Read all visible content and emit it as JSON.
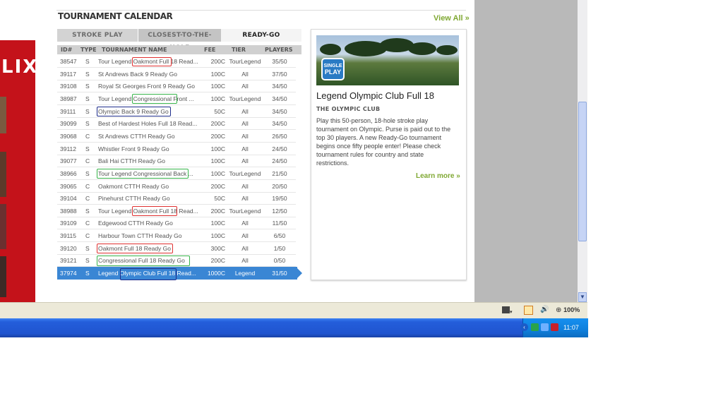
{
  "calendar": {
    "title": "TOURNAMENT CALENDAR",
    "view_all": "View All »"
  },
  "tabs": [
    {
      "label": "STROKE PLAY",
      "active": false
    },
    {
      "label": "CLOSEST-TO-THE-HOLE",
      "active": false
    },
    {
      "label": "READY-GO",
      "active": true
    }
  ],
  "columns": [
    "ID#",
    "TYPE",
    "TOURNAMENT NAME",
    "FEE",
    "TIER",
    "PLAYERS"
  ],
  "rows": [
    {
      "id": "38547",
      "type": "S",
      "name": "Tour Legend Oakmont Full 18 Read...",
      "fee": "200C",
      "tier": "TourLegend",
      "players": "35/50"
    },
    {
      "id": "39117",
      "type": "S",
      "name": "St Andrews Back 9 Ready Go",
      "fee": "100C",
      "tier": "All",
      "players": "37/50"
    },
    {
      "id": "39108",
      "type": "S",
      "name": "Royal St Georges Front 9 Ready Go",
      "fee": "100C",
      "tier": "All",
      "players": "34/50"
    },
    {
      "id": "38987",
      "type": "S",
      "name": "Tour Legend Congressional Front ...",
      "fee": "100C",
      "tier": "TourLegend",
      "players": "34/50"
    },
    {
      "id": "39111",
      "type": "S",
      "name": "Olympic Back 9 Ready Go",
      "fee": "50C",
      "tier": "All",
      "players": "34/50"
    },
    {
      "id": "39099",
      "type": "S",
      "name": "Best of Hardest Holes Full 18 Read...",
      "fee": "200C",
      "tier": "All",
      "players": "34/50"
    },
    {
      "id": "39068",
      "type": "C",
      "name": "St Andrews CTTH Ready Go",
      "fee": "200C",
      "tier": "All",
      "players": "26/50"
    },
    {
      "id": "39112",
      "type": "S",
      "name": "Whistler Front 9 Ready Go",
      "fee": "100C",
      "tier": "All",
      "players": "24/50"
    },
    {
      "id": "39077",
      "type": "C",
      "name": "Bali Hai CTTH Ready Go",
      "fee": "100C",
      "tier": "All",
      "players": "24/50"
    },
    {
      "id": "38966",
      "type": "S",
      "name": "Tour Legend Congressional Back ...",
      "fee": "100C",
      "tier": "TourLegend",
      "players": "21/50"
    },
    {
      "id": "39065",
      "type": "C",
      "name": "Oakmont CTTH Ready Go",
      "fee": "200C",
      "tier": "All",
      "players": "20/50"
    },
    {
      "id": "39104",
      "type": "C",
      "name": "Pinehurst CTTH Ready Go",
      "fee": "50C",
      "tier": "All",
      "players": "19/50"
    },
    {
      "id": "38988",
      "type": "S",
      "name": "Tour Legend Oakmont Full 18 Read...",
      "fee": "200C",
      "tier": "TourLegend",
      "players": "12/50"
    },
    {
      "id": "39109",
      "type": "C",
      "name": "Edgewood CTTH Ready Go",
      "fee": "100C",
      "tier": "All",
      "players": "11/50"
    },
    {
      "id": "39115",
      "type": "C",
      "name": "Harbour Town CTTH Ready Go",
      "fee": "100C",
      "tier": "All",
      "players": "6/50"
    },
    {
      "id": "39120",
      "type": "S",
      "name": "Oakmont Full 18 Ready Go",
      "fee": "300C",
      "tier": "All",
      "players": "1/50"
    },
    {
      "id": "39121",
      "type": "S",
      "name": "Congressional Full 18 Ready Go",
      "fee": "200C",
      "tier": "All",
      "players": "0/50"
    },
    {
      "id": "37974",
      "type": "S",
      "name": "Legend Olympic Club Full 18 Read...",
      "fee": "1000C",
      "tier": "Legend",
      "players": "31/50",
      "selected": true
    }
  ],
  "featured": {
    "badge_line1": "SINGLE",
    "badge_line2": "PLAY",
    "title": "Legend Olympic Club Full 18",
    "subtitle": "THE OLYMPIC CLUB",
    "description": "Play this 50-person, 18-hole stroke play tournament on Olympic. Purse is paid out to the top 30 players. A new Ready-Go tournament begins once fifty people enter! Please check tournament rules for country and state restrictions.",
    "learn_more": "Learn more »"
  },
  "promo": {
    "text": "LIX"
  },
  "statusbar": {
    "zoom": "100%"
  },
  "taskbar": {
    "clock": "11:07"
  },
  "colors": {
    "accent_green": "#7fa832",
    "selected_row": "#3a86d4",
    "promo_red": "#c4121a"
  }
}
